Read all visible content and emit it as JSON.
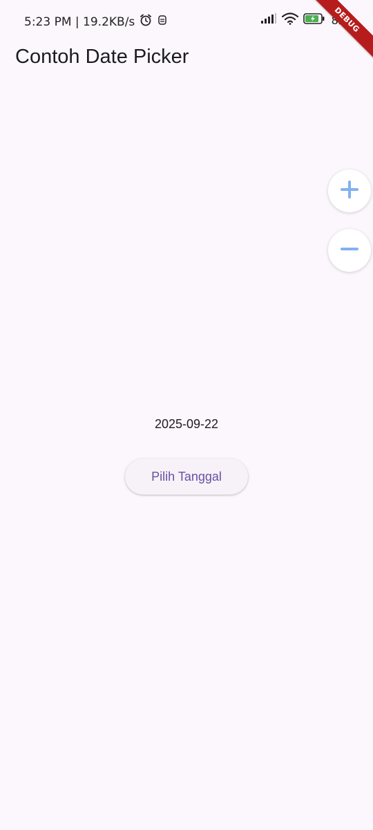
{
  "status_bar": {
    "time_speed": "5:23 PM | 19.2KB/s",
    "battery": "82",
    "icons": [
      "alarm-icon",
      "notification-icon",
      "signal-icon",
      "wifi-icon",
      "battery-icon"
    ]
  },
  "debug_banner": "DEBUG",
  "app_bar": {
    "title": "Contoh Date Picker"
  },
  "zoom": {
    "in_icon": "plus-icon",
    "out_icon": "minus-icon",
    "icon_color": "#82b1f0"
  },
  "main": {
    "selected_date": "2025-09-22",
    "pick_button_label": "Pilih Tanggal"
  },
  "colors": {
    "background": "#fcf7fd",
    "accent": "#6750a4",
    "debug": "#b71c1c"
  }
}
